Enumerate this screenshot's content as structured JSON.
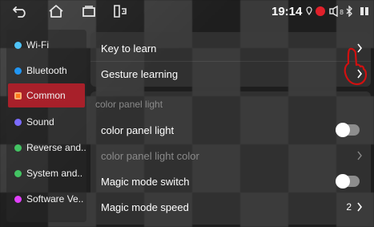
{
  "statusbar": {
    "time": "19:14",
    "icons": [
      "back-icon",
      "home-icon",
      "recents-icon",
      "split-screen-icon",
      "location-icon",
      "record-icon",
      "volume-icon",
      "bluetooth-icon",
      "battery-icon"
    ]
  },
  "sidebar": {
    "items": [
      {
        "label": "Wi-Fi",
        "color": "#4fc3f7",
        "icon": "wifi-icon"
      },
      {
        "label": "Bluetooth",
        "color": "#2196f3",
        "icon": "bluetooth-icon"
      },
      {
        "label": "Common",
        "color": "#ff7a1a",
        "icon": "common-icon",
        "active": true
      },
      {
        "label": "Sound",
        "color": "#7c6cff",
        "icon": "sound-icon"
      },
      {
        "label": "Reverse and..",
        "color": "#43c463",
        "icon": "reverse-icon"
      },
      {
        "label": "System and..",
        "color": "#43c463",
        "icon": "system-icon"
      },
      {
        "label": "Software Ve..",
        "color": "#e040fb",
        "icon": "software-icon"
      }
    ]
  },
  "main": {
    "key_to_learn": "Key to learn",
    "gesture_learning": "Gesture learning",
    "section_header": "color panel light",
    "color_panel_light": "color panel light",
    "color_panel_light_color": "color panel light color",
    "magic_mode_switch": "Magic mode switch",
    "magic_mode_speed": "Magic mode speed",
    "magic_mode_speed_value": "2"
  },
  "colors": {
    "accent_active": "#a8202a",
    "record_red": "#e0202a",
    "annotation_red": "#d01010"
  }
}
